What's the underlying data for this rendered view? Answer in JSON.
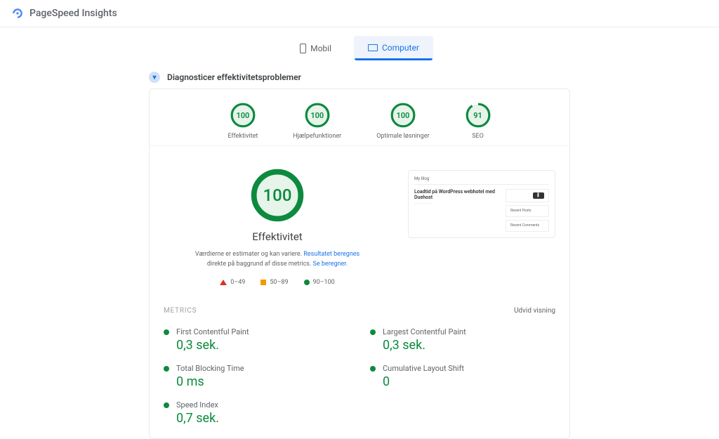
{
  "app": {
    "title": "PageSpeed Insights"
  },
  "tabs": {
    "mobile": "Mobil",
    "computer": "Computer"
  },
  "diag": {
    "title": "Diagnosticer effektivitetsproblemer"
  },
  "gauges": [
    {
      "score": "100",
      "label": "Effektivitet",
      "pct": 100
    },
    {
      "score": "100",
      "label": "Hjælpefunktioner",
      "pct": 100
    },
    {
      "score": "100",
      "label": "Optimale løsninger",
      "pct": 100
    },
    {
      "score": "91",
      "label": "SEO",
      "pct": 91
    }
  ],
  "big": {
    "score": "100",
    "title": "Effektivitet",
    "desc_pre": "Værdierne er estimater og kan variere. ",
    "desc_link1": "Resultatet beregnes",
    "desc_mid": " direkte på baggrund af disse metrics. ",
    "desc_link2": "Se beregner."
  },
  "legend": {
    "bad": "0–49",
    "mid": "50–89",
    "good": "90–100"
  },
  "thumb": {
    "site": "My blog",
    "heading": "Loadtid på WordPress webhotel med Duehost",
    "widget1": "Recent Posts",
    "widget2": "Recent Comments"
  },
  "metrics_section": {
    "title": "METRICS",
    "expand": "Udvid visning"
  },
  "metrics": [
    {
      "label": "First Contentful Paint",
      "value": "0,3 sek."
    },
    {
      "label": "Largest Contentful Paint",
      "value": "0,3 sek."
    },
    {
      "label": "Total Blocking Time",
      "value": "0 ms"
    },
    {
      "label": "Cumulative Layout Shift",
      "value": "0"
    },
    {
      "label": "Speed Index",
      "value": "0,7 sek."
    }
  ]
}
